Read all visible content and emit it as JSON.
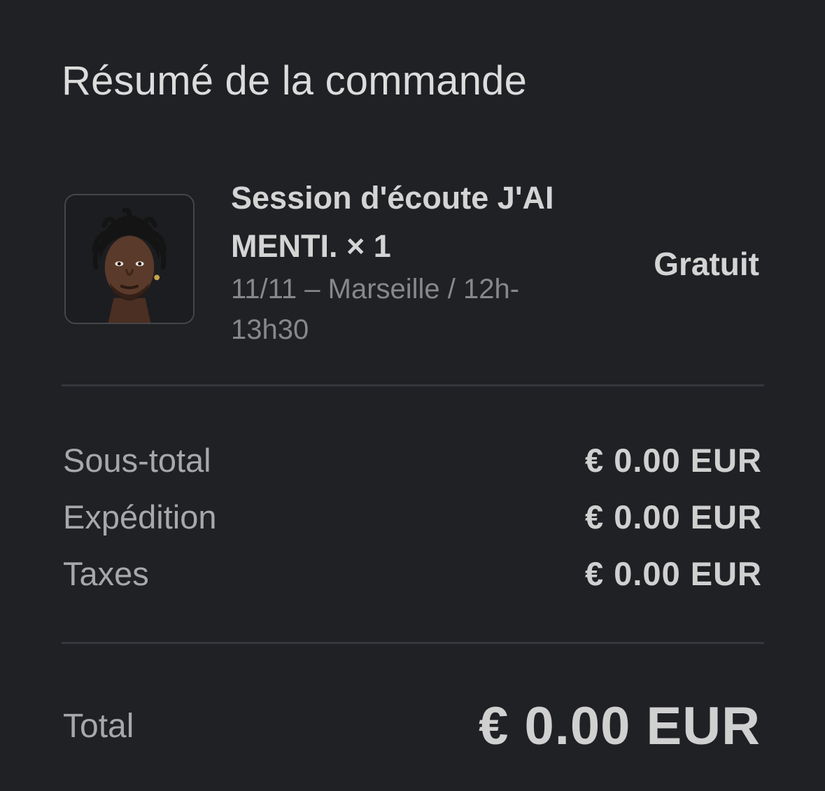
{
  "summary": {
    "title": "Résumé de la commande"
  },
  "item": {
    "image_icon": "artist-portrait",
    "name": "Session d'écoute J'AI MENTI. × 1",
    "variant": "11/11 – Marseille / 12h-13h30",
    "price": "Gratuit"
  },
  "costs": [
    {
      "label": "Sous-total",
      "value": "€ 0.00 EUR"
    },
    {
      "label": "Expédition",
      "value": "€ 0.00 EUR"
    },
    {
      "label": "Taxes",
      "value": "€ 0.00 EUR"
    }
  ],
  "total": {
    "label": "Total",
    "value": "€ 0.00 EUR"
  },
  "colors": {
    "background": "#202125",
    "divider": "#36373c",
    "primary_text": "#d4d4d4",
    "secondary_text": "#87888c"
  }
}
